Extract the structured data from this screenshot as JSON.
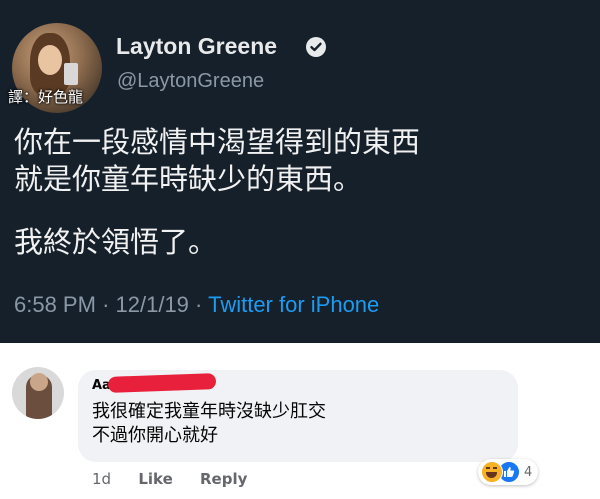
{
  "tweet": {
    "translator_credit": "譯：好色龍",
    "display_name": "Layton Greene",
    "handle": "@LaytonGreene",
    "text_lines": [
      "你在一段感情中渴望得到的東西",
      "就是你童年時缺少的東西。",
      "我終於領悟了。"
    ],
    "time": "6:58 PM",
    "date": "12/1/19",
    "separator": "·",
    "source": "Twitter for iPhone"
  },
  "comment": {
    "commenter_name_visible": "Aa",
    "text_lines": [
      "我很確定我童年時沒缺少肛交",
      "不過你開心就好"
    ],
    "time_ago": "1d",
    "like_label": "Like",
    "reply_label": "Reply",
    "reaction_count": "4",
    "reactions": [
      "haha-icon",
      "like-icon"
    ]
  },
  "colors": {
    "tweet_bg": "#15202b",
    "twitter_blue": "#1d9bf0",
    "redaction": "#e8203c",
    "bubble_bg": "#f0f2f5"
  }
}
